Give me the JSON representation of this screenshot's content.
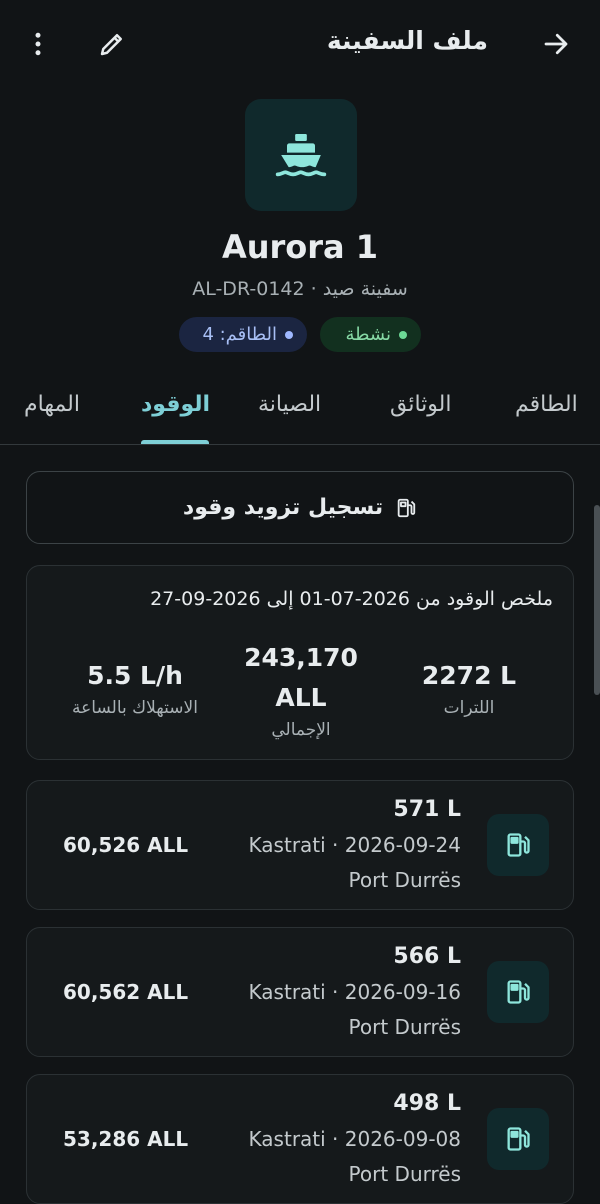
{
  "app_bar": {
    "title": "ملف السفينة"
  },
  "vessel": {
    "name": "Aurora 1",
    "subtitle": "AL-DR-0142 · سفينة صيد",
    "status": "نشطة",
    "crew": "الطاقم: 4"
  },
  "tabs": [
    "الطاقم",
    "الوثائق",
    "الصيانة",
    "الوقود",
    "المهام"
  ],
  "active_tab": "الوقود",
  "log_button": {
    "label": "تسجيل تزويد وقود"
  },
  "summary": {
    "title": "ملخص الوقود من 2026-07-01 إلى 2026-09-27",
    "litres_value": "2272 L",
    "litres_label": "اللترات",
    "total_value_line1": "243,170",
    "total_value_line2": "ALL",
    "total_label": "الإجمالي",
    "rate_value": "5.5 L/h",
    "rate_label": "الاستهلاك بالساعة"
  },
  "entries": [
    {
      "litres": "571 L",
      "meta": "Kastrati · 2026-09-24",
      "port": "Port Durrës",
      "cost": "60,526 ALL"
    },
    {
      "litres": "566 L",
      "meta": "Kastrati · 2026-09-16",
      "port": "Port Durrës",
      "cost": "60,562 ALL"
    },
    {
      "litres": "498 L",
      "meta": "Kastrati · 2026-09-08",
      "port": "Port Durrës",
      "cost": "53,286 ALL"
    }
  ],
  "colors": {
    "accent": "#7ecfd6",
    "background": "#111416",
    "card": "#15191b",
    "status_green": "#6cd895",
    "crew_blue": "#9fb8ff"
  },
  "icons": {
    "back": "arrow-right-icon",
    "edit": "pencil-icon",
    "more": "more-vertical-icon",
    "vessel": "ship-icon",
    "fuel": "fuel-pump-icon"
  }
}
